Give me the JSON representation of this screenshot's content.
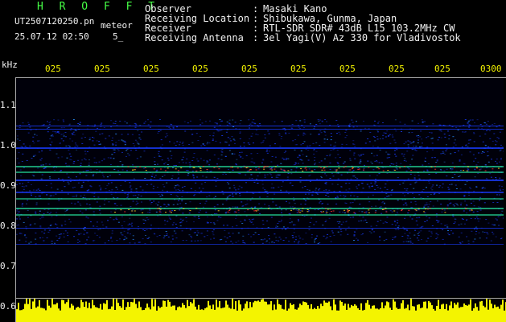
{
  "brand": "H R O F F T",
  "file": {
    "name": "UT2507120250.pn",
    "mode": "meteor",
    "datetime": "25.07.12 02:50",
    "interval": "5_"
  },
  "info": [
    {
      "key": "Observer",
      "sep": ":",
      "value": "Masaki Kano"
    },
    {
      "key": "Receiving Location",
      "sep": ":",
      "value": "Shibukawa, Gunma, Japan"
    },
    {
      "key": "Receiver",
      "sep": ":",
      "value": "RTL-SDR SDR# 43dB L15 103.2MHz CW"
    },
    {
      "key": "Receiving Antenna",
      "sep": ":",
      "value": "3el Yagi(V) Az 330 for Vladivostok"
    }
  ],
  "yaxis": {
    "unit": "kHz",
    "ticks": [
      "1.1",
      "1.0",
      "0.9",
      "0.8",
      "0.7",
      "0.6"
    ]
  },
  "xaxis": {
    "ticks": [
      "025",
      "025",
      "025",
      "025",
      "025",
      "025",
      "025",
      "025",
      "025",
      "0300"
    ]
  },
  "colors": {
    "text": "#f2f2f2",
    "brand": "#46ff46",
    "time_labels": "#f4f400",
    "bars": "#f4f400",
    "band_low": "#1a3cff",
    "band_mid": "#29ffb0",
    "band_high": "#ff3030"
  }
}
